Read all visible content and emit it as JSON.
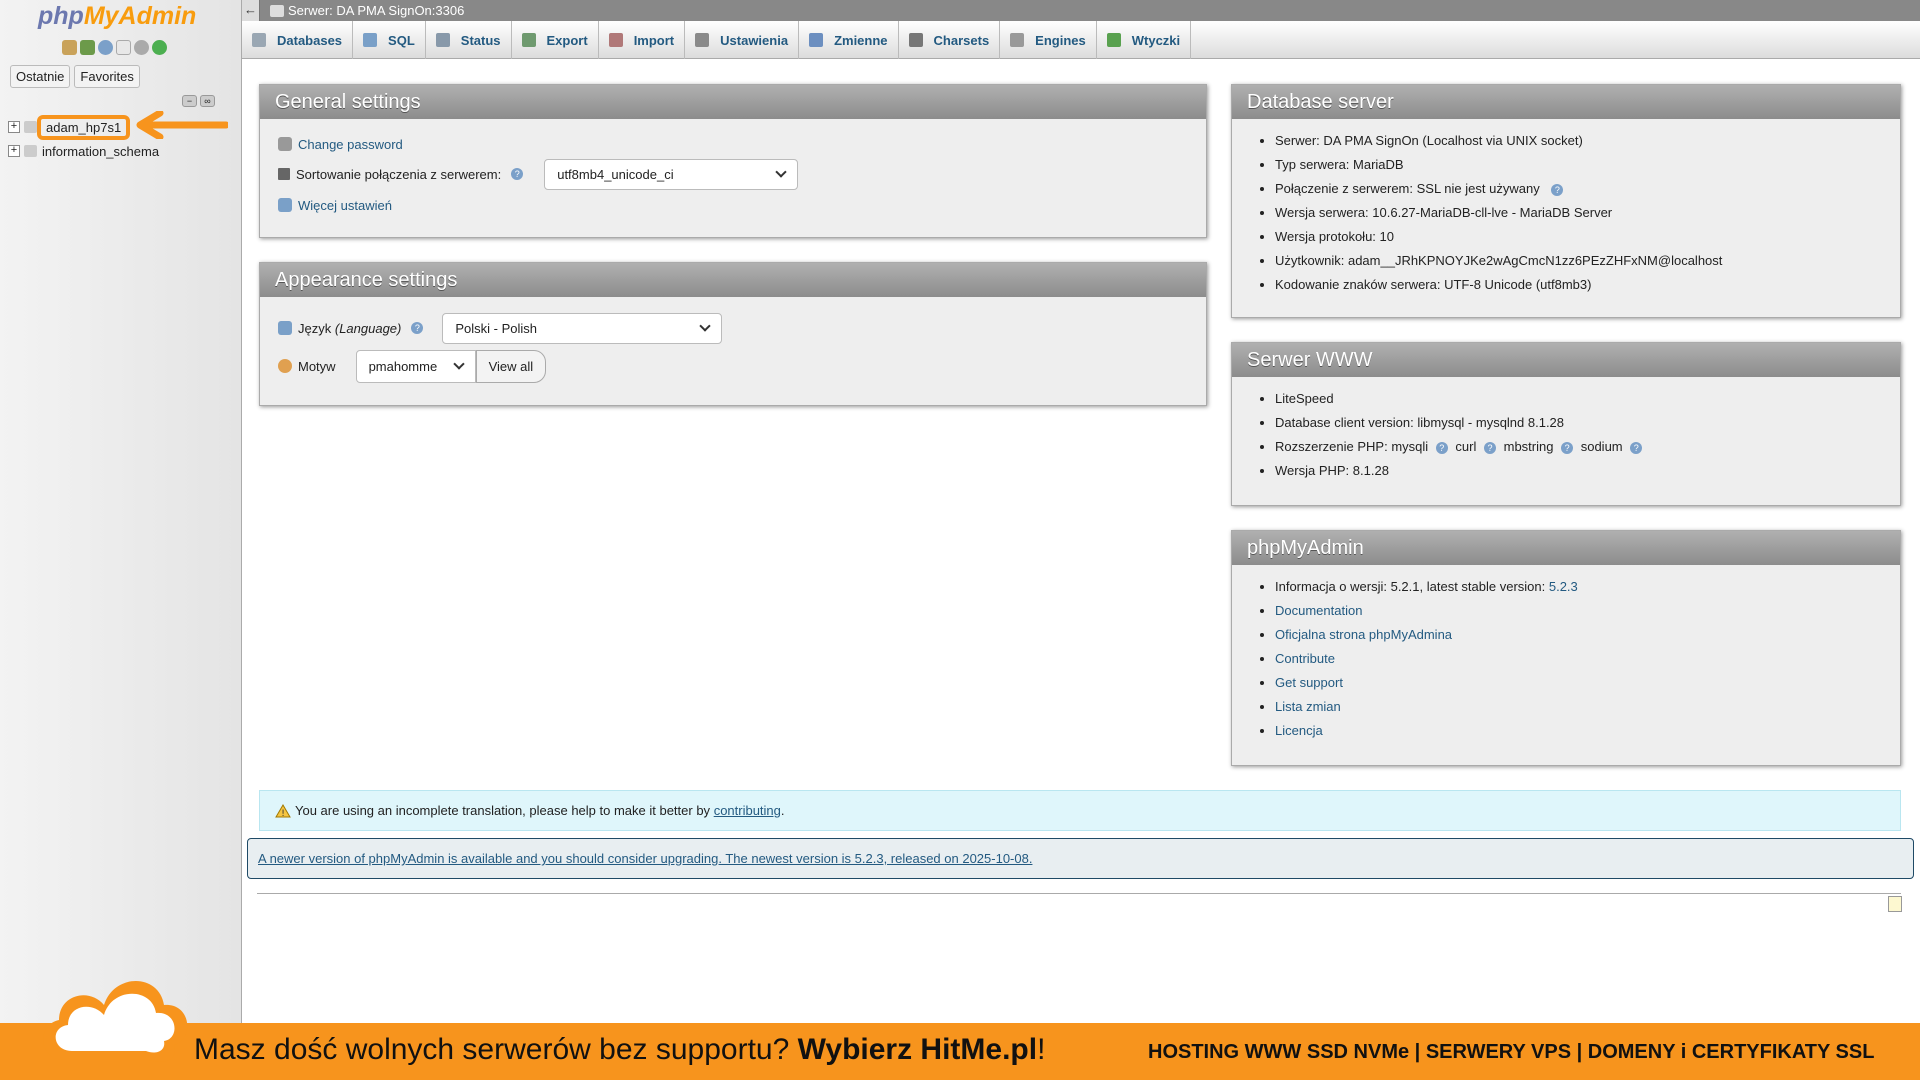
{
  "sidebar": {
    "logo_part1": "php",
    "logo_part2": "MyAdmin",
    "tabs": [
      "Ostatnie",
      "Favorites"
    ],
    "tree": [
      {
        "label": "adam_hp7s1",
        "highlighted": true
      },
      {
        "label": "information_schema",
        "highlighted": false
      }
    ]
  },
  "serverbar": {
    "title": "Serwer: DA PMA SignOn:3306"
  },
  "tabs": [
    {
      "label": "Databases",
      "icon": "database-icon",
      "color": "#9aa7b3"
    },
    {
      "label": "SQL",
      "icon": "sql-icon",
      "color": "#7aa0c8"
    },
    {
      "label": "Status",
      "icon": "status-icon",
      "color": "#8899aa"
    },
    {
      "label": "Export",
      "icon": "export-icon",
      "color": "#6f9a6f"
    },
    {
      "label": "Import",
      "icon": "import-icon",
      "color": "#b07878"
    },
    {
      "label": "Ustawienia",
      "icon": "wrench-icon",
      "color": "#8a8a8a"
    },
    {
      "label": "Zmienne",
      "icon": "variables-icon",
      "color": "#6c8fc0"
    },
    {
      "label": "Charsets",
      "icon": "charsets-icon",
      "color": "#777777"
    },
    {
      "label": "Engines",
      "icon": "engines-icon",
      "color": "#999999"
    },
    {
      "label": "Wtyczki",
      "icon": "plugin-icon",
      "color": "#59a14f"
    }
  ],
  "general": {
    "title": "General settings",
    "change_password": "Change password",
    "collation_label": "Sortowanie połączenia z serwerem:",
    "collation_value": "utf8mb4_unicode_ci",
    "more_settings": "Więcej ustawień"
  },
  "appearance": {
    "title": "Appearance settings",
    "language_label": "Język",
    "language_label_en": "(Language)",
    "language_value": "Polski - Polish",
    "theme_label": "Motyw",
    "theme_value": "pmahomme",
    "view_all": "View all"
  },
  "db_server": {
    "title": "Database server",
    "items": [
      "Serwer: DA PMA SignOn (Localhost via UNIX socket)",
      "Typ serwera: MariaDB",
      "Połączenie z serwerem: SSL nie jest używany",
      "Wersja serwera: 10.6.27-MariaDB-cll-lve - MariaDB Server",
      "Wersja protokołu: 10",
      "Użytkownik: adam__JRhKPNOYJKe2wAgCmcN1zz6PEzZHFxNM@localhost",
      "Kodowanie znaków serwera: UTF-8 Unicode (utf8mb3)"
    ]
  },
  "web_server": {
    "title": "Serwer WWW",
    "items": [
      "LiteSpeed",
      "Database client version: libmysql - mysqlnd 8.1.28"
    ],
    "php_ext_label": "Rozszerzenie PHP: mysqli",
    "php_ext_2": "curl",
    "php_ext_3": "mbstring",
    "php_ext_4": "sodium",
    "php_version": "Wersja PHP: 8.1.28"
  },
  "pma": {
    "title": "phpMyAdmin",
    "version_text": "Informacja o wersji: 5.2.1, latest stable version: ",
    "version_link": "5.2.3",
    "links": [
      "Documentation",
      "Oficjalna strona phpMyAdmina",
      "Contribute",
      "Get support",
      "Lista zmian",
      "Licencja"
    ]
  },
  "notice": {
    "text": "You are using an incomplete translation, please help to make it better by ",
    "link": "contributing",
    "end": "."
  },
  "upgrade": {
    "text": "A newer version of phpMyAdmin is available and you should consider upgrading. The newest version is 5.2.3, released on 2025-10-08."
  },
  "banner": {
    "left_text": "Masz dość wolnych serwerów bez supportu? ",
    "left_bold": "Wybierz HitMe.pl",
    "left_end": "!",
    "right_text": "HOSTING WWW SSD NVMe | SERWERY VPS | DOMENY i CERTYFIKATY SSL",
    "color": "#f7941d"
  }
}
